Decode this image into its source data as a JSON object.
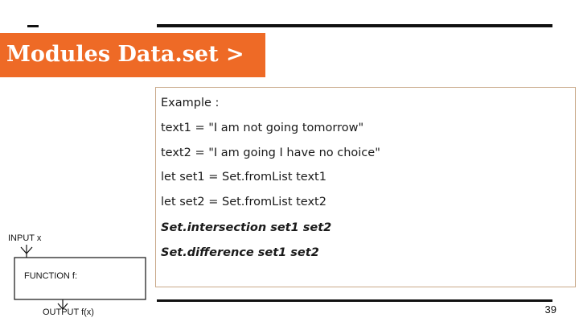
{
  "slide": {
    "title": "Modules Data.set >",
    "page_number": "39"
  },
  "example": {
    "lines": [
      "Example :",
      "text1 = \"I am not going tomorrow\"",
      "text2 = \"I am going I have no choice\"",
      "let set1 = Set.fromList text1",
      "let set2 = Set.fromList text2",
      "Set.intersection set1 set2",
      "Set.difference set1 set2"
    ]
  },
  "diagram": {
    "input_label": "INPUT x",
    "function_label": "FUNCTION f:",
    "output_label": "OUTPUT f(x)"
  },
  "colors": {
    "accent": "#ee6a26",
    "box_border": "#c9a98a"
  }
}
